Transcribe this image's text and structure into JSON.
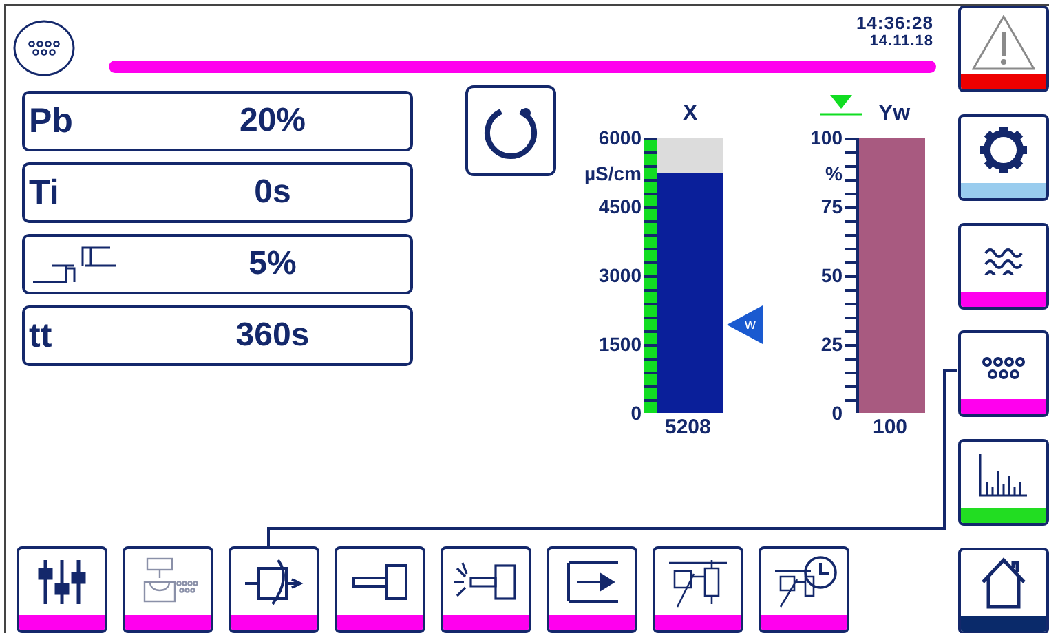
{
  "header": {
    "time": "14:36:28",
    "date": "14.11.18"
  },
  "parameters": [
    {
      "kind": "text",
      "label": "Pb",
      "value": "20%"
    },
    {
      "kind": "text",
      "label": "Ti",
      "value": "0s"
    },
    {
      "kind": "step",
      "value": "5%"
    },
    {
      "kind": "text",
      "label": "tt",
      "value": "360s"
    }
  ],
  "gauges": [
    {
      "kind": "measure",
      "title": "X",
      "unit": "µS/cm",
      "ticks": [
        "6000",
        "4500",
        "3000",
        "1500",
        "0"
      ],
      "reading": "5208",
      "level": 0.868,
      "setpoint": {
        "label": "w",
        "level": 0.32
      }
    },
    {
      "kind": "output",
      "title": "Yw",
      "unit": "%",
      "ticks": [
        "100",
        "75",
        "50",
        "25",
        "0"
      ],
      "reading": "100",
      "level": 1.0
    }
  ],
  "side_nav": [
    {
      "kind": "warning",
      "color": "#ee0000"
    },
    {
      "kind": "gear",
      "color": "#99ccee"
    },
    {
      "kind": "waves",
      "color": "#ff00ee"
    },
    {
      "kind": "dots",
      "color": "#ff00ee"
    },
    {
      "kind": "chart",
      "color": "#22dd22"
    },
    {
      "kind": "home",
      "color": "#0a2a6a"
    }
  ],
  "toolbar": [
    {
      "kind": "sliders",
      "color": "#ff00ee"
    },
    {
      "kind": "valve-dots",
      "color": "#ff00ee"
    },
    {
      "kind": "controller",
      "color": "#ff00ee"
    },
    {
      "kind": "actuator",
      "color": "#ff00ee"
    },
    {
      "kind": "actuator-signal",
      "color": "#ff00ee"
    },
    {
      "kind": "arrow-in",
      "color": "#ff00ee"
    },
    {
      "kind": "valve",
      "color": "#ff00ee"
    },
    {
      "kind": "valve-clock",
      "color": "#ff00ee"
    }
  ]
}
